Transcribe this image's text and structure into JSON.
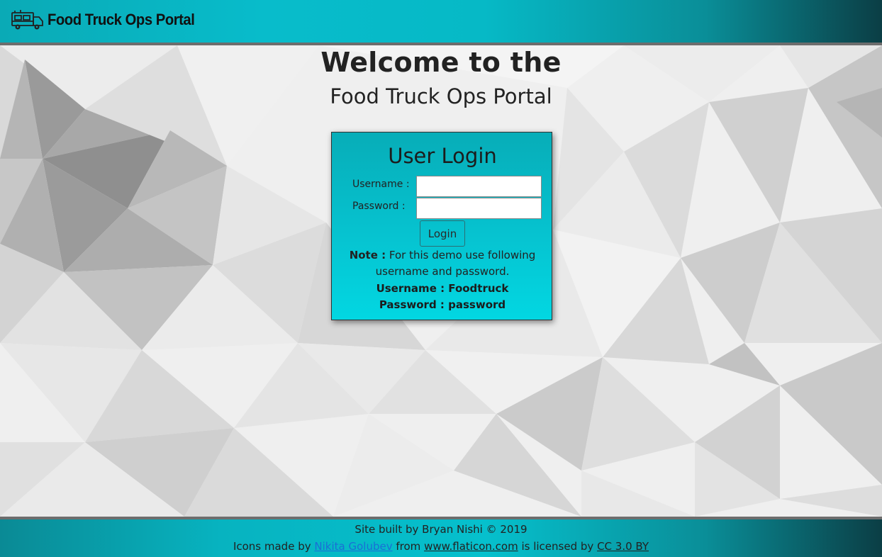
{
  "header": {
    "brand_title": "Food Truck Ops Portal",
    "logo_icon": "food-truck-icon"
  },
  "welcome": {
    "line1": "Welcome to the",
    "line2": "Food Truck Ops Portal"
  },
  "login": {
    "title": "User Login",
    "username_label": "Username :",
    "password_label": "Password :",
    "username_value": "",
    "password_value": "",
    "button_label": "Login",
    "note_prefix": "Note :",
    "note_text": "For this demo use following username and password.",
    "cred_username": "Username : Foodtruck",
    "cred_password": "Password : password"
  },
  "footer": {
    "built_by": "Site built by Bryan Nishi © 2019",
    "icons_prefix": "Icons made by",
    "author_link": "Nikita Golubev",
    "from_text": "from",
    "site_link": "www.flaticon.com",
    "licensed_text": "is licensed by",
    "license_link": "CC 3.0 BY"
  },
  "colors": {
    "teal": "#06bfcc",
    "dark_teal": "#0b3e45",
    "link_blue": "#1a6fd6",
    "border_gray": "#6d6d6d"
  }
}
